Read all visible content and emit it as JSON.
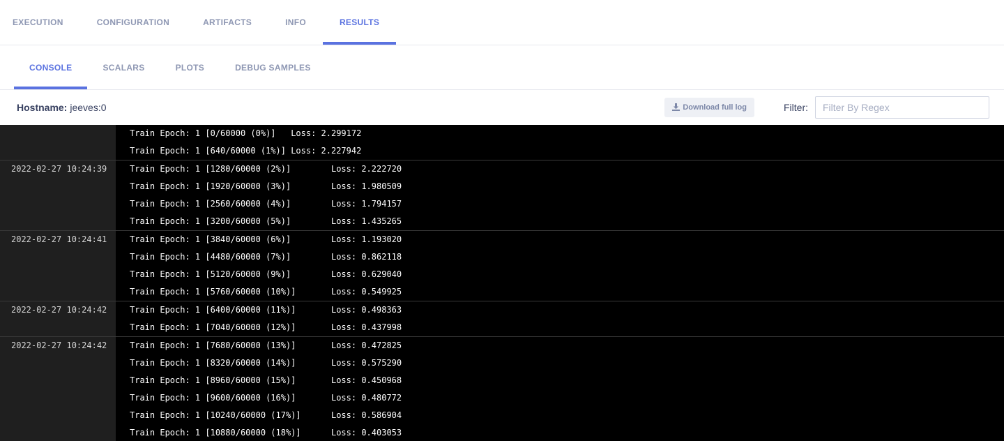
{
  "top_tabs": [
    "EXECUTION",
    "CONFIGURATION",
    "ARTIFACTS",
    "INFO",
    "RESULTS"
  ],
  "top_tab_active": "RESULTS",
  "sub_tabs": [
    "CONSOLE",
    "SCALARS",
    "PLOTS",
    "DEBUG SAMPLES"
  ],
  "sub_tab_active": "CONSOLE",
  "toolbar": {
    "hostname_label": "Hostname:",
    "hostname_value": "jeeves:0",
    "download_label": "Download full log",
    "filter_label": "Filter:",
    "filter_placeholder": "Filter By Regex",
    "filter_value": ""
  },
  "colors": {
    "accent": "#5a72e0",
    "tab_inactive": "#8e97b3",
    "console_bg": "#000000",
    "timestamp_bg": "#1f1f1f"
  },
  "log_groups": [
    {
      "timestamp": "",
      "lines": [
        "Train Epoch: 1 [0/60000 (0%)]   Loss: 2.299172",
        "Train Epoch: 1 [640/60000 (1%)] Loss: 2.227942"
      ]
    },
    {
      "timestamp": "2022-02-27 10:24:39",
      "lines": [
        "Train Epoch: 1 [1280/60000 (2%)]        Loss: 2.222720",
        "Train Epoch: 1 [1920/60000 (3%)]        Loss: 1.980509",
        "Train Epoch: 1 [2560/60000 (4%)]        Loss: 1.794157",
        "Train Epoch: 1 [3200/60000 (5%)]        Loss: 1.435265"
      ]
    },
    {
      "timestamp": "2022-02-27 10:24:41",
      "lines": [
        "Train Epoch: 1 [3840/60000 (6%)]        Loss: 1.193020",
        "Train Epoch: 1 [4480/60000 (7%)]        Loss: 0.862118",
        "Train Epoch: 1 [5120/60000 (9%)]        Loss: 0.629040",
        "Train Epoch: 1 [5760/60000 (10%)]       Loss: 0.549925"
      ]
    },
    {
      "timestamp": "2022-02-27 10:24:42",
      "lines": [
        "Train Epoch: 1 [6400/60000 (11%)]       Loss: 0.498363",
        "Train Epoch: 1 [7040/60000 (12%)]       Loss: 0.437998"
      ]
    },
    {
      "timestamp": "2022-02-27 10:24:42",
      "lines": [
        "Train Epoch: 1 [7680/60000 (13%)]       Loss: 0.472825",
        "Train Epoch: 1 [8320/60000 (14%)]       Loss: 0.575290",
        "Train Epoch: 1 [8960/60000 (15%)]       Loss: 0.450968",
        "Train Epoch: 1 [9600/60000 (16%)]       Loss: 0.480772",
        "Train Epoch: 1 [10240/60000 (17%)]      Loss: 0.586904",
        "Train Epoch: 1 [10880/60000 (18%)]      Loss: 0.403053"
      ]
    }
  ]
}
